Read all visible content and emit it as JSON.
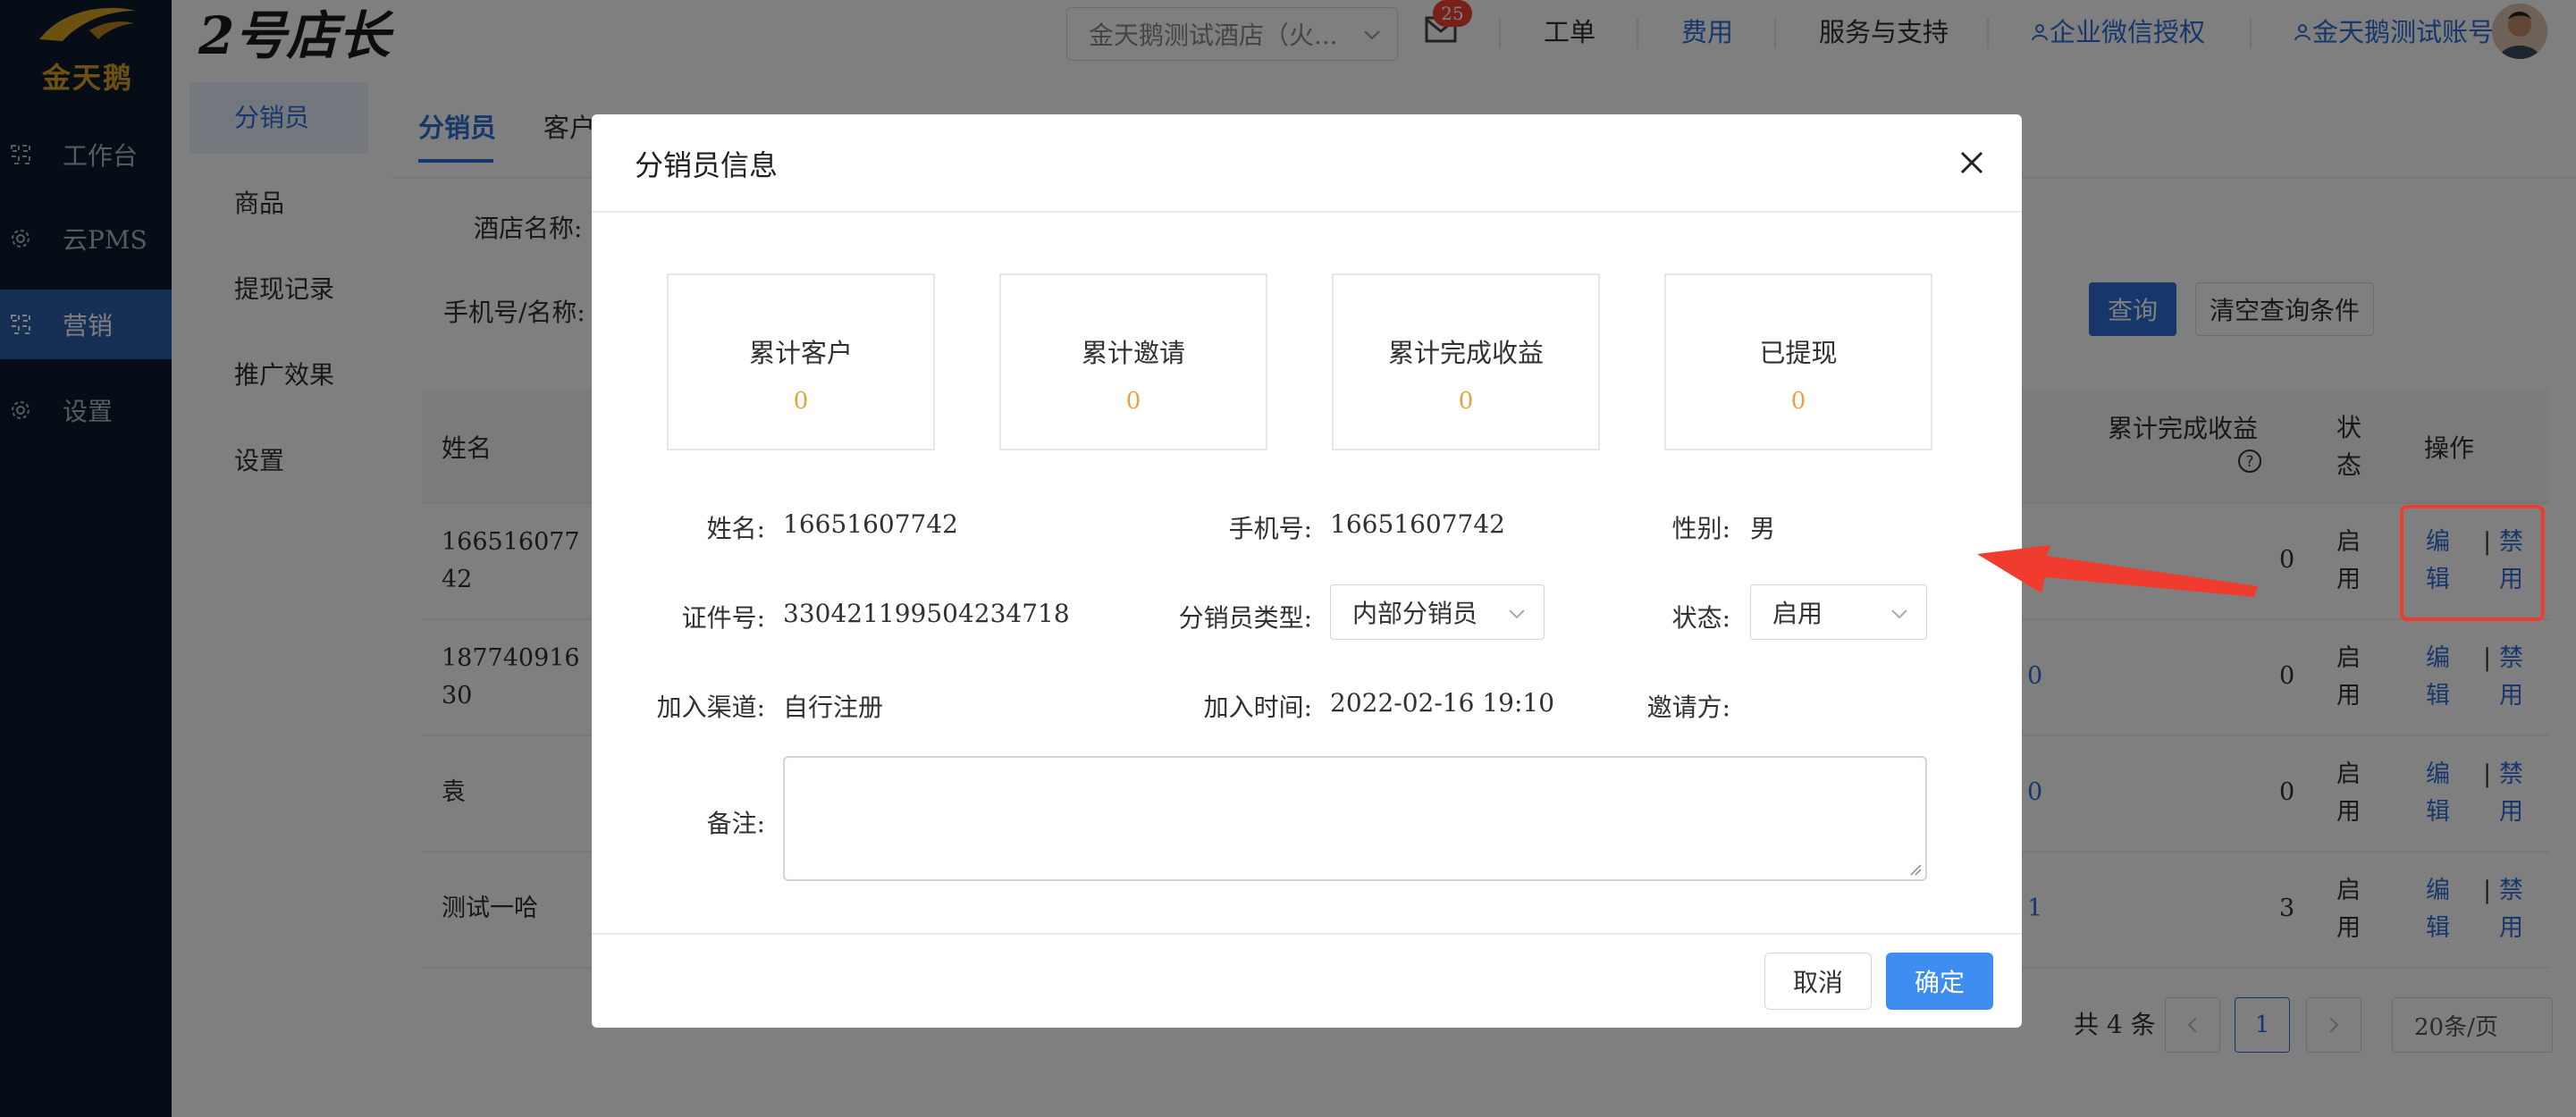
{
  "colors": {
    "accent": "#2f6fd7",
    "annotation": "#f03c2e",
    "stat_value": "#e6a23c",
    "primary_button": "#3d8ef0"
  },
  "sidebar": {
    "logo_text": "金天鹅",
    "items": [
      {
        "label": "工作台",
        "icon": "workbench-icon"
      },
      {
        "label": "云PMS",
        "icon": "gear-icon"
      },
      {
        "label": "营销",
        "icon": "workbench-icon",
        "active": true
      },
      {
        "label": "设置",
        "icon": "gear-icon"
      }
    ]
  },
  "header": {
    "app_title": "2号店长",
    "hotel_select": "金天鹅测试酒店（火...",
    "mail_badge": "25",
    "links": [
      "工单",
      "费用",
      "服务与支持",
      "企业微信授权",
      "金天鹅测试账号"
    ]
  },
  "subnav": {
    "items": [
      "分销员",
      "商品",
      "提现记录",
      "推广效果",
      "设置"
    ]
  },
  "page": {
    "tabs": [
      "分销员",
      "客户"
    ],
    "filters": {
      "hotel_label": "酒店名称:",
      "phone_label": "手机号/名称:"
    },
    "query_button": "查询",
    "clear_button": "清空查询条件",
    "table": {
      "headers": {
        "name": "姓名",
        "earnings": "累计完成收益",
        "status": "状态",
        "actions": "操作"
      },
      "rows": [
        {
          "name": "16651607742",
          "mid": "",
          "earnings": "0",
          "status": "启用",
          "edit": "编辑",
          "disable": "禁用"
        },
        {
          "name": "18774091630",
          "mid": "0",
          "earnings": "0",
          "status": "启用",
          "edit": "编辑",
          "disable": "禁用"
        },
        {
          "name": "袁",
          "mid": "0",
          "earnings": "0",
          "status": "启用",
          "edit": "编辑",
          "disable": "禁用"
        },
        {
          "name": "测试一哈",
          "mid": "1",
          "earnings": "3",
          "status": "启用",
          "edit": "编辑",
          "disable": "禁用"
        }
      ]
    },
    "pagination": {
      "total": "共 4 条",
      "current_page": "1",
      "page_size": "20条/页"
    }
  },
  "modal": {
    "title": "分销员信息",
    "stats": [
      {
        "label": "累计客户",
        "value": "0"
      },
      {
        "label": "累计邀请",
        "value": "0"
      },
      {
        "label": "累计完成收益",
        "value": "0"
      },
      {
        "label": "已提现",
        "value": "0"
      }
    ],
    "fields": {
      "name_label": "姓名:",
      "name_value": "16651607742",
      "phone_label": "手机号:",
      "phone_value": "16651607742",
      "gender_label": "性别:",
      "gender_value": "男",
      "id_label": "证件号:",
      "id_value": "330421199504234718",
      "type_label": "分销员类型:",
      "type_value": "内部分销员",
      "status_label": "状态:",
      "status_value": "启用",
      "channel_label": "加入渠道:",
      "channel_value": "自行注册",
      "join_time_label": "加入时间:",
      "join_time_value": "2022-02-16 19:10",
      "inviter_label": "邀请方:",
      "inviter_value": "",
      "remark_label": "备注:",
      "remark_value": ""
    },
    "cancel_button": "取消",
    "ok_button": "确定"
  }
}
